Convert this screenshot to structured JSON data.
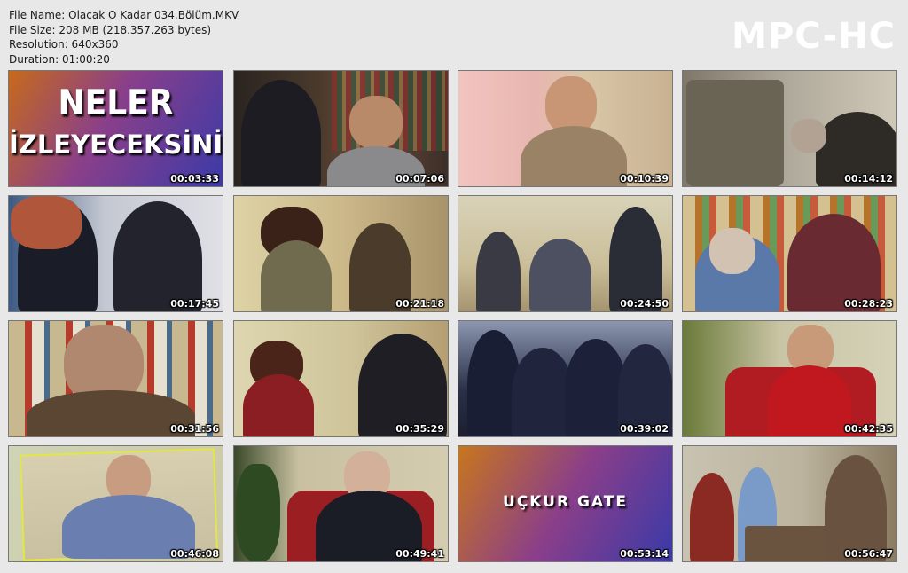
{
  "file_info": {
    "name": "File Name: Olacak O Kadar 034.Bölüm.MKV",
    "size": "File Size: 208 MB (218.357.263 bytes)",
    "resolution": "Resolution: 640x360",
    "duration": "Duration: 01:00:20"
  },
  "logo": "MPC-HC",
  "thumbnails": [
    {
      "time": "00:03:33",
      "overlay": [
        "NELER",
        "İZLEYECEKSİNİZ"
      ]
    },
    {
      "time": "00:07:06"
    },
    {
      "time": "00:10:39"
    },
    {
      "time": "00:14:12"
    },
    {
      "time": "00:17:45"
    },
    {
      "time": "00:21:18"
    },
    {
      "time": "00:24:50"
    },
    {
      "time": "00:28:23"
    },
    {
      "time": "00:31:56"
    },
    {
      "time": "00:35:29"
    },
    {
      "time": "00:39:02"
    },
    {
      "time": "00:42:35"
    },
    {
      "time": "00:46:08"
    },
    {
      "time": "00:49:41"
    },
    {
      "time": "00:53:14",
      "overlay": [
        "UÇKUR GATE"
      ]
    },
    {
      "time": "00:56:47"
    }
  ],
  "colors": {
    "background": "#e8e8e8",
    "logo": "#ffffff",
    "timestamp": "#ffffff"
  }
}
